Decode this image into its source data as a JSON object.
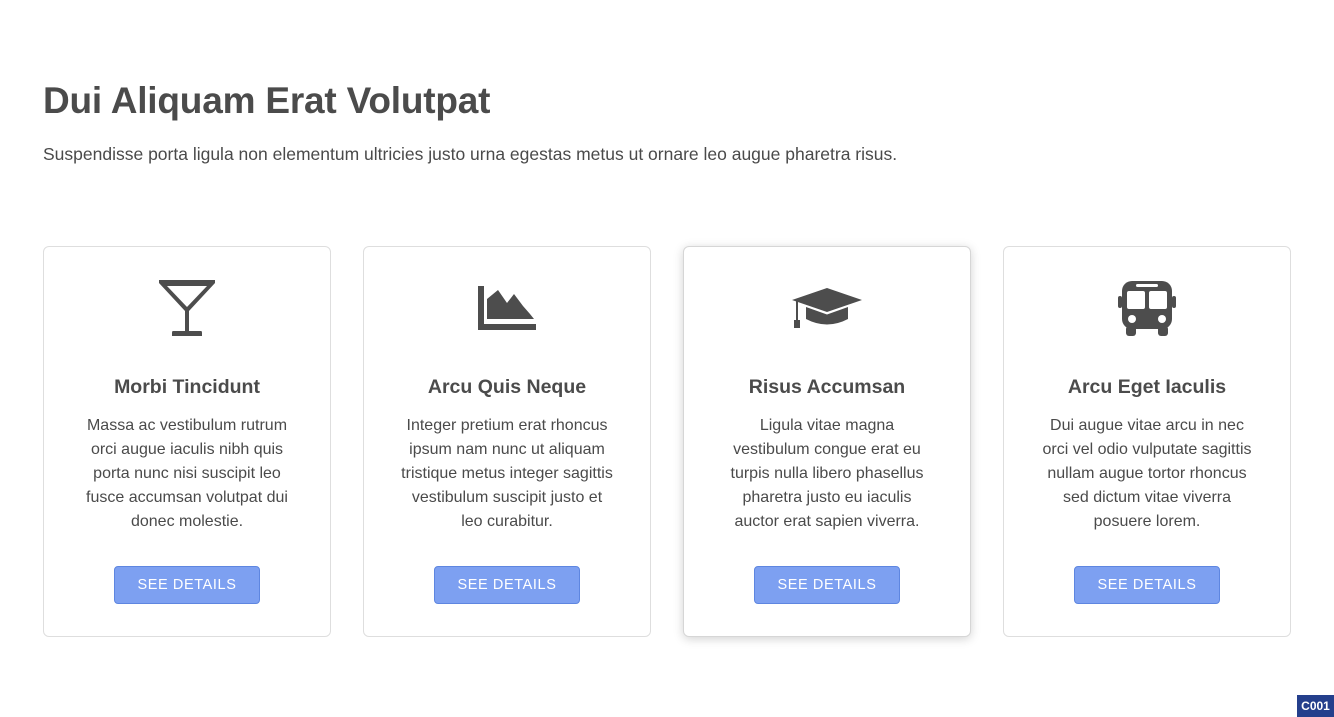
{
  "header": {
    "title": "Dui Aliquam Erat Volutpat",
    "subtitle": "Suspendisse porta ligula non elementum ultricies justo urna egestas metus ut ornare leo augue pharetra risus."
  },
  "cards": [
    {
      "icon": "cocktail-icon",
      "title": "Morbi Tincidunt",
      "text": "Massa ac vestibulum rutrum orci augue iaculis nibh quis porta nunc nisi suscipit leo fusce accumsan volutpat dui donec molestie.",
      "button_label": "SEE DETAILS"
    },
    {
      "icon": "area-chart-icon",
      "title": "Arcu Quis Neque",
      "text": "Integer pretium erat rhoncus ipsum nam nunc ut aliquam tristique metus integer sagittis vestibulum suscipit justo et leo curabitur.",
      "button_label": "SEE DETAILS"
    },
    {
      "icon": "graduation-cap-icon",
      "title": "Risus Accumsan",
      "text": "Ligula vitae magna vestibulum congue erat eu turpis nulla libero phasellus pharetra justo eu iaculis auctor erat sapien viverra.",
      "button_label": "SEE DETAILS"
    },
    {
      "icon": "bus-icon",
      "title": "Arcu Eget Iaculis",
      "text": "Dui augue vitae arcu in nec orci vel odio vulputate sagittis nullam augue tortor rhoncus sed dictum vitae viverra posuere lorem.",
      "button_label": "SEE DETAILS"
    }
  ],
  "corner_tag": "C001",
  "colors": {
    "button_bg": "#7da0f1",
    "button_border": "#5e86e0",
    "text": "#4a4a4a",
    "icon": "#4d4d4d",
    "tag_bg": "#243f8c"
  }
}
